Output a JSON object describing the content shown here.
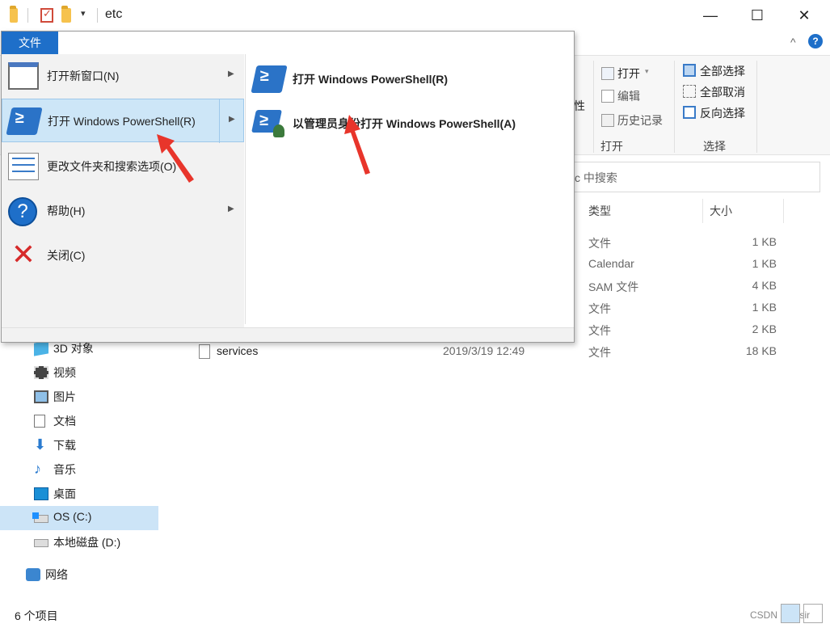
{
  "title_bar": {
    "path_label": "etc",
    "minimize": "—",
    "maximize": "☐",
    "close": "✕"
  },
  "ribbon": {
    "collapse": "^",
    "help": "?",
    "open_group": {
      "open": "打开",
      "edit": "编辑",
      "history": "历史记录",
      "label": "打开",
      "properties_partial": "性"
    },
    "select_group": {
      "select_all": "全部选择",
      "select_none": "全部取消",
      "invert": "反向选择",
      "label": "选择"
    }
  },
  "search": {
    "placeholder": "c 中搜索"
  },
  "columns": {
    "type": "类型",
    "size": "大小"
  },
  "files": [
    {
      "type": "文件",
      "size": "1 KB"
    },
    {
      "type": "Calendar",
      "size": "1 KB"
    },
    {
      "type": "SAM 文件",
      "size": "4 KB"
    },
    {
      "type": "文件",
      "size": "1 KB"
    },
    {
      "type": "文件",
      "size": "2 KB"
    },
    {
      "name": "services",
      "date": "2019/3/19 12:49",
      "type": "文件",
      "size": "18 KB"
    }
  ],
  "nav": {
    "items": [
      {
        "label": "3D 对象"
      },
      {
        "label": "视频"
      },
      {
        "label": "图片"
      },
      {
        "label": "文档"
      },
      {
        "label": "下载"
      },
      {
        "label": "音乐"
      },
      {
        "label": "桌面"
      },
      {
        "label": "OS (C:)"
      },
      {
        "label": "本地磁盘 (D:)"
      }
    ],
    "network": "网络"
  },
  "status": {
    "count": "6 个项目",
    "watermark": "CSDN @赫sir"
  },
  "file_menu": {
    "tab": "文件",
    "left": [
      {
        "label": "打开新窗口(N)"
      },
      {
        "label": "打开 Windows PowerShell(R)"
      },
      {
        "label": "更改文件夹和搜索选项(O)"
      },
      {
        "label": "帮助(H)"
      },
      {
        "label": "关闭(C)"
      }
    ],
    "right": [
      {
        "label": "打开 Windows PowerShell(R)"
      },
      {
        "label": "以管理员身份打开 Windows PowerShell(A)"
      }
    ]
  },
  "colors": {
    "accent": "#1e6fc9",
    "highlight": "#cde6f7",
    "annotation": "#e8352b"
  }
}
